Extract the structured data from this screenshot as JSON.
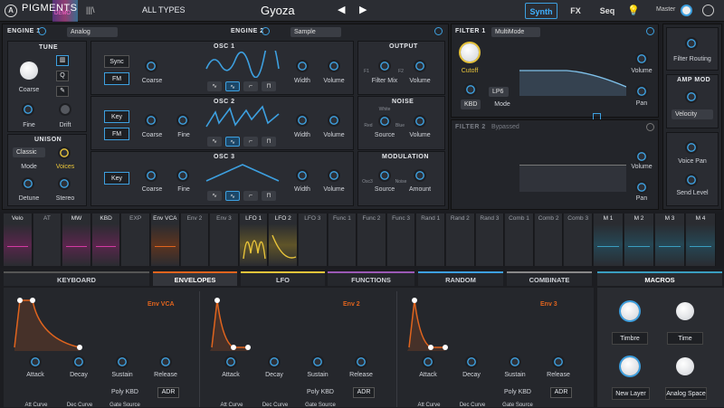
{
  "topbar": {
    "logo": "A",
    "app": "PIGMENTS",
    "demo": "DEMO",
    "library_icon": "library-icon",
    "preset_type": "ALL TYPES",
    "preset_name": "Gyoza",
    "prev": "◀",
    "next": "▶",
    "tabs": {
      "synth": "Synth",
      "fx": "FX",
      "seq": "Seq"
    },
    "master_label": "Master"
  },
  "engine1": {
    "title": "ENGINE 1",
    "type": "Analog",
    "tune": {
      "title": "TUNE",
      "coarse": "Coarse",
      "fine": "Fine",
      "drift": "Drift"
    },
    "unison": {
      "title": "UNISON",
      "mode_value": "Classic",
      "mode": "Mode",
      "voices": "Voices",
      "detune": "Detune",
      "stereo": "Stereo"
    },
    "osc1": {
      "title": "OSC 1",
      "sync": "Sync",
      "fm": "FM",
      "coarse": "Coarse",
      "width": "Width",
      "volume": "Volume"
    },
    "osc2": {
      "title": "OSC 2",
      "key": "Key",
      "fm": "FM",
      "coarse": "Coarse",
      "fine": "Fine",
      "width": "Width",
      "volume": "Volume"
    },
    "osc3": {
      "title": "OSC 3",
      "key": "Key",
      "coarse": "Coarse",
      "fine": "Fine",
      "width": "Width",
      "volume": "Volume"
    },
    "output": {
      "title": "OUTPUT",
      "f1": "F1",
      "f2": "F2",
      "filter_mix": "Filter Mix",
      "volume": "Volume"
    },
    "noise": {
      "title": "NOISE",
      "white": "White",
      "red": "Red",
      "blue": "Blue",
      "source": "Source",
      "volume": "Volume"
    },
    "modulation": {
      "title": "MODULATION",
      "osc3": "Osc3",
      "noise": "Noise",
      "source": "Source",
      "amount": "Amount"
    }
  },
  "engine2": {
    "title": "ENGINE 2",
    "type": "Sample"
  },
  "filter1": {
    "title": "FILTER 1",
    "type": "MultiMode",
    "cutoff": "Cutoff",
    "kbd_value": "KBD",
    "mode_value": "LP6",
    "mode": "Mode",
    "volume": "Volume",
    "pan": "Pan"
  },
  "filter2": {
    "title": "FILTER 2",
    "status": "Bypassed",
    "volume": "Volume",
    "pan": "Pan"
  },
  "right": {
    "filter_routing": "Filter Routing",
    "amp_mod": "AMP MOD",
    "velocity": "Velocity",
    "voice_pan": "Voice Pan",
    "send_level": "Send Level"
  },
  "mod_sources": [
    "Velo",
    "AT",
    "MW",
    "KBD",
    "EXP",
    "Env VCA",
    "Env 2",
    "Env 3",
    "LFO 1",
    "LFO 2",
    "LFO 3",
    "Func 1",
    "Func 2",
    "Func 3",
    "Rand 1",
    "Rand 2",
    "Rand 3",
    "Comb 1",
    "Comb 2",
    "Comb 3",
    "M 1",
    "M 2",
    "M 3",
    "M 4"
  ],
  "bottom_tabs": [
    "KEYBOARD",
    "ENVELOPES",
    "LFO",
    "FUNCTIONS",
    "RANDOM",
    "COMBINATE",
    "MACROS"
  ],
  "envelopes": [
    {
      "name": "Env VCA",
      "attack": "Attack",
      "decay": "Decay",
      "sustain": "Sustain",
      "release": "Release",
      "trigger": "Poly KBD",
      "mode": "ADR",
      "att_curve": "Att Curve",
      "dec_curve": "Dec Curve",
      "gate": "Gate Source"
    },
    {
      "name": "Env 2",
      "attack": "Attack",
      "decay": "Decay",
      "sustain": "Sustain",
      "release": "Release",
      "trigger": "Poly KBD",
      "mode": "ADR",
      "att_curve": "Att Curve",
      "dec_curve": "Dec Curve",
      "gate": "Gate Source"
    },
    {
      "name": "Env 3",
      "attack": "Attack",
      "decay": "Decay",
      "sustain": "Sustain",
      "release": "Release",
      "trigger": "Poly KBD",
      "mode": "ADR",
      "att_curve": "Att Curve",
      "dec_curve": "Dec Curve",
      "gate": "Gate Source"
    }
  ],
  "macros": {
    "timbre": "Timbre",
    "time": "Time",
    "new_layer": "New Layer",
    "analog_space": "Analog Space"
  },
  "colors": {
    "accent": "#3da0e0",
    "envelope": "#e0641e",
    "lfo": "#e8c43a",
    "macro": "#3a9ec0",
    "velo": "#d33aa3"
  }
}
